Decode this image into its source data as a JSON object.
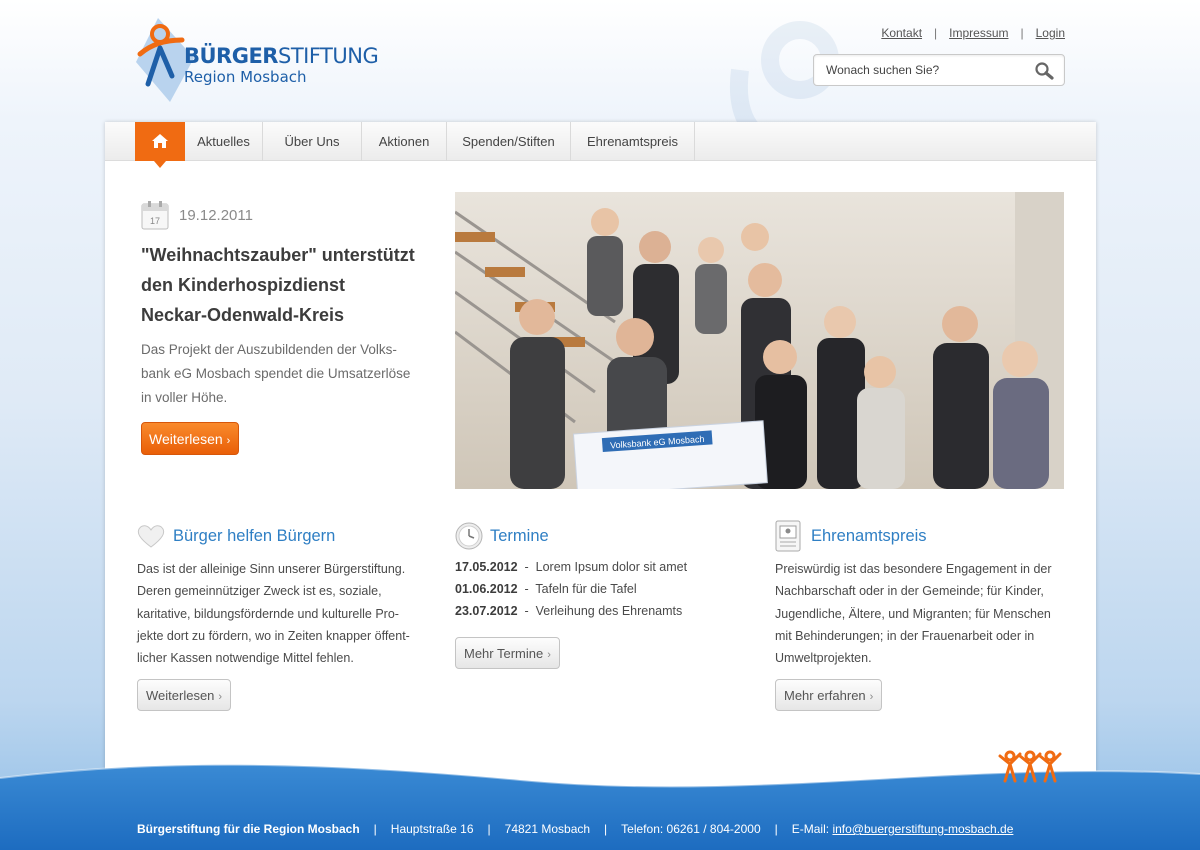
{
  "logo": {
    "title_bold": "BÜRGER",
    "title_rest": "STIFTUNG",
    "subtitle": "Region Mosbach"
  },
  "toplinks": {
    "kontakt": "Kontakt",
    "impressum": "Impressum",
    "login": "Login",
    "separator": "|"
  },
  "search": {
    "placeholder": "Wonach suchen Sie?",
    "icon": "search-icon"
  },
  "nav": {
    "home_icon": "home-icon",
    "items": [
      "Aktuelles",
      "Über Uns",
      "Aktionen",
      "Spenden/Stiften",
      "Ehrenamtspreis"
    ],
    "active": "home"
  },
  "featured": {
    "calendar_day": "17",
    "date": "19.12.2011",
    "title_line1": "\"Weihnachtszauber\" unterstützt",
    "title_line2": "den Kinderhospizdienst",
    "title_line3": "Neckar-Odenwald-Kreis",
    "text_line1": "Das Projekt der Auszubildenden der Volks-",
    "text_line2": "bank eG Mosbach spendet die Umsatzerlöse",
    "text_line3": "in voller Höhe.",
    "button": "Weiterlesen",
    "photo_sign": "Volksbank eG Mosbach"
  },
  "col1": {
    "icon": "heart-icon",
    "title": "Bürger helfen Bürgern",
    "lines": [
      "Das ist der alleinige Sinn unserer Bürgerstiftung.",
      "Deren gemeinnütziger Zweck ist es, soziale,",
      "karitative, bildungsfördernde und kulturelle Pro-",
      "jekte dort zu fördern, wo in Zeiten knapper öffent-",
      "licher Kassen notwendige Mittel fehlen."
    ],
    "button": "Weiterlesen"
  },
  "col2": {
    "icon": "clock-icon",
    "title": "Termine",
    "events": [
      {
        "date": "17.05.2012",
        "sep": "-",
        "text": "Lorem Ipsum dolor sit amet"
      },
      {
        "date": "01.06.2012",
        "sep": "-",
        "text": "Tafeln für die Tafel"
      },
      {
        "date": "23.07.2012",
        "sep": "-",
        "text": "Verleihung des Ehrenamts"
      }
    ],
    "button": "Mehr Termine"
  },
  "col3": {
    "icon": "document-icon",
    "title": "Ehrenamtspreis",
    "lines": [
      "Preiswürdig ist das besondere Engagement in der",
      "Nachbarschaft oder in der Gemeinde; für Kinder,",
      "Jugendliche, Ältere, und Migranten; für Menschen",
      "mit Behinderungen; in der Frauenarbeit oder in",
      "Umweltprojekten."
    ],
    "button": "Mehr erfahren"
  },
  "footer": {
    "org": "Bürgerstiftung für die Region Mosbach",
    "street": "Hauptstraße 16",
    "city": "74821 Mosbach",
    "phone": "Telefon: 06261 / 804-2000",
    "email_label": "E-Mail:",
    "email": "info@buergerstiftung-mosbach.de",
    "separator": "|"
  },
  "colors": {
    "brand_blue": "#1e5fa8",
    "accent_orange": "#f06b12",
    "heading_blue": "#2f7fc4"
  }
}
